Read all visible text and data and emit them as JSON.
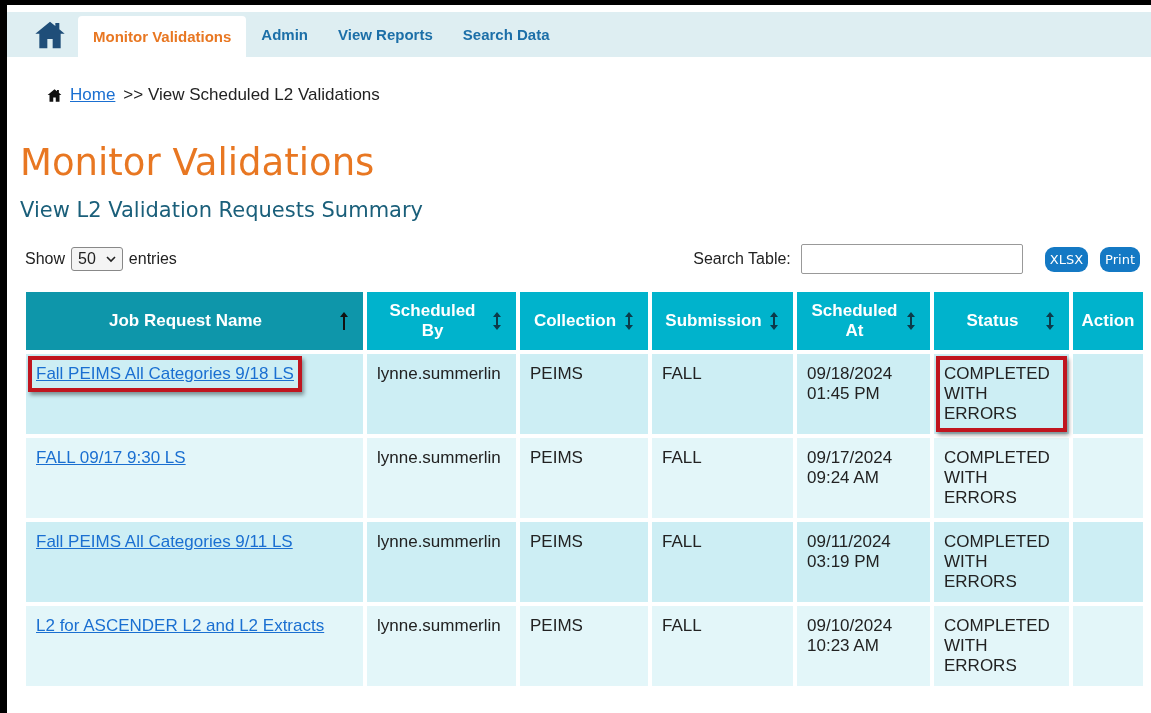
{
  "nav": {
    "tabs": [
      {
        "label": "Monitor Validations",
        "selected": true
      },
      {
        "label": "Admin",
        "selected": false
      },
      {
        "label": "View Reports",
        "selected": false
      },
      {
        "label": "Search Data",
        "selected": false
      }
    ]
  },
  "breadcrumb": {
    "link": "Home",
    "separator": ">>",
    "current": "View Scheduled L2 Validations"
  },
  "title": "Monitor Validations",
  "subtitle": "View L2 Validation Requests Summary",
  "controls": {
    "show_label": "Show",
    "page_size": "50",
    "entries_label": "entries",
    "search_label": "Search Table:",
    "buttons": [
      "XLSX",
      "Print"
    ]
  },
  "table": {
    "columns": [
      {
        "label": "Job Request Name",
        "sorted": true,
        "sortable": true
      },
      {
        "label": "Scheduled By",
        "sorted": false,
        "sortable": true
      },
      {
        "label": "Collection",
        "sorted": false,
        "sortable": true
      },
      {
        "label": "Submission",
        "sorted": false,
        "sortable": true
      },
      {
        "label": "Scheduled At",
        "sorted": false,
        "sortable": true
      },
      {
        "label": "Status",
        "sorted": false,
        "sortable": true
      },
      {
        "label": "Action",
        "sorted": false,
        "sortable": false
      }
    ],
    "rows": [
      {
        "name": "Fall PEIMS All Categories 9/18 LS",
        "by": "lynne.summerlin",
        "collection": "PEIMS",
        "submission": "FALL",
        "date": "09/18/2024",
        "time": "01:45 PM",
        "status": "COMPLETED WITH ERRORS",
        "highlighted": true
      },
      {
        "name": "FALL 09/17 9:30 LS",
        "by": "lynne.summerlin",
        "collection": "PEIMS",
        "submission": "FALL",
        "date": "09/17/2024",
        "time": "09:24 AM",
        "status": "COMPLETED WITH ERRORS",
        "highlighted": false
      },
      {
        "name": "Fall PEIMS All Categories 9/11 LS",
        "by": "lynne.summerlin",
        "collection": "PEIMS",
        "submission": "FALL",
        "date": "09/11/2024",
        "time": "03:19 PM",
        "status": "COMPLETED WITH ERRORS",
        "highlighted": false
      },
      {
        "name": "L2 for ASCENDER L2 and L2 Extracts",
        "by": "lynne.summerlin",
        "collection": "PEIMS",
        "submission": "FALL",
        "date": "09/10/2024",
        "time": "10:23 AM",
        "status": "COMPLETED WITH ERRORS",
        "highlighted": false
      }
    ]
  }
}
